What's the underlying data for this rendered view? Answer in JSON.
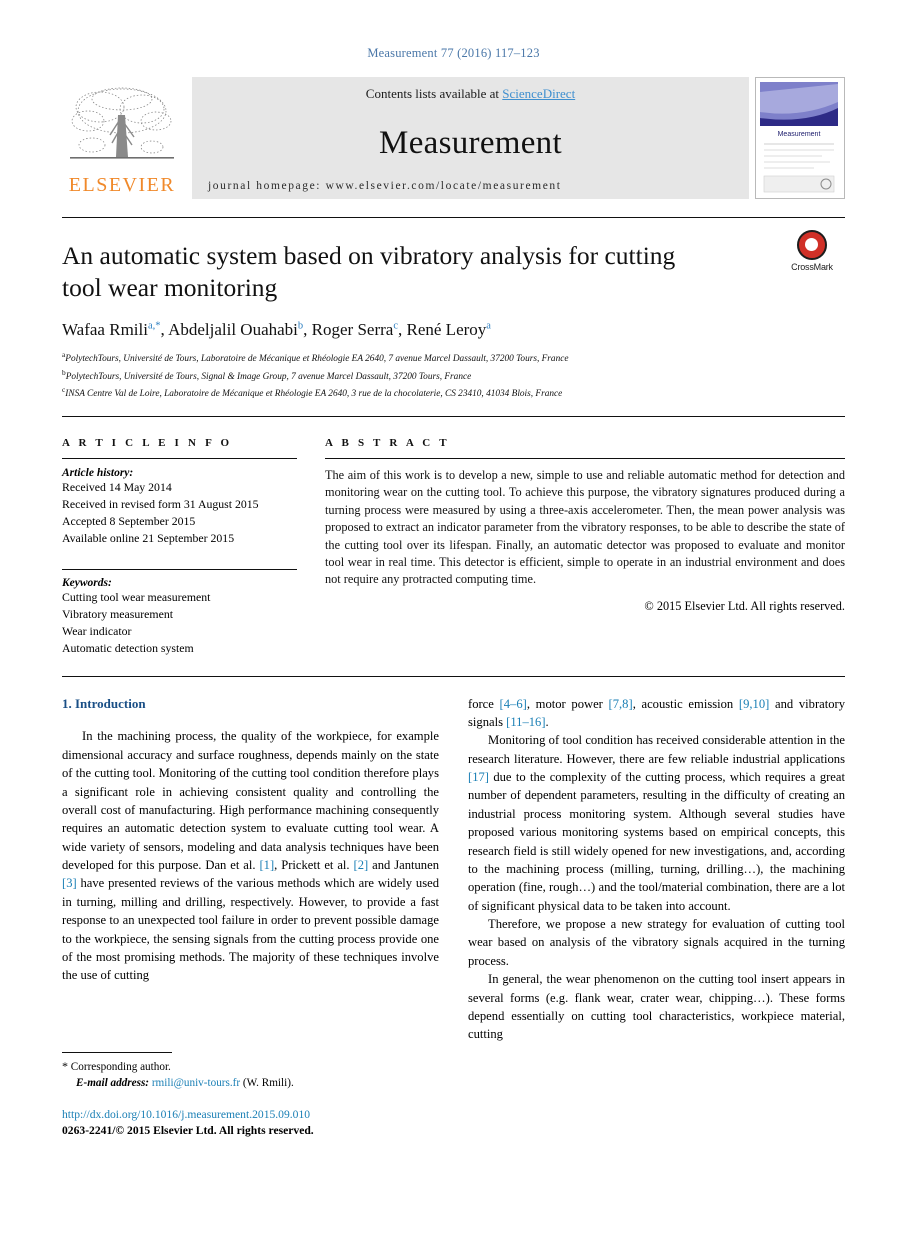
{
  "running_head": "Measurement 77 (2016) 117–123",
  "masthead": {
    "contents_prefix": "Contents lists available at ",
    "sciencedirect": "ScienceDirect",
    "journal_name": "Measurement",
    "homepage": "journal homepage: www.elsevier.com/locate/measurement",
    "publisher_logo_text": "ELSEVIER",
    "cover_journal_name": "Measurement"
  },
  "article": {
    "title": "An automatic system based on vibratory analysis for cutting tool wear monitoring",
    "authors": [
      {
        "name": "Wafaa Rmili",
        "marks": "a,*"
      },
      {
        "name": "Abdeljalil Ouahabi",
        "marks": "b"
      },
      {
        "name": "Roger Serra",
        "marks": "c"
      },
      {
        "name": "René Leroy",
        "marks": "a"
      }
    ],
    "authors_line": "Wafaa Rmili a,*, Abdeljalil Ouahabi b, Roger Serra c, René Leroy a",
    "affiliations": [
      {
        "mark": "a",
        "text": "PolytechTours, Université de Tours, Laboratoire de Mécanique et Rhéologie EA 2640, 7 avenue Marcel Dassault, 37200 Tours, France"
      },
      {
        "mark": "b",
        "text": "PolytechTours, Université de Tours, Signal & Image Group, 7 avenue Marcel Dassault, 37200 Tours, France"
      },
      {
        "mark": "c",
        "text": "INSA Centre Val de Loire, Laboratoire de Mécanique et Rhéologie EA 2640, 3 rue de la chocolaterie, CS 23410, 41034 Blois, France"
      }
    ],
    "crossmark_label": "CrossMark"
  },
  "article_info": {
    "heading": "A R T I C L E   I N F O",
    "history_label": "Article history:",
    "history": [
      "Received 14 May 2014",
      "Received in revised form 31 August 2015",
      "Accepted 8 September 2015",
      "Available online 21 September 2015"
    ],
    "keywords_label": "Keywords:",
    "keywords": [
      "Cutting tool wear measurement",
      "Vibratory measurement",
      "Wear indicator",
      "Automatic detection system"
    ]
  },
  "abstract": {
    "heading": "A B S T R A C T",
    "text": "The aim of this work is to develop a new, simple to use and reliable automatic method for detection and monitoring wear on the cutting tool. To achieve this purpose, the vibratory signatures produced during a turning process were measured by using a three-axis accelerometer. Then, the mean power analysis was proposed to extract an indicator parameter from the vibratory responses, to be able to describe the state of the cutting tool over its lifespan. Finally, an automatic detector was proposed to evaluate and monitor tool wear in real time. This detector is efficient, simple to operate in an industrial environment and does not require any protracted computing time.",
    "copyright": "© 2015 Elsevier Ltd. All rights reserved."
  },
  "body": {
    "section_title": "1. Introduction",
    "left_p1_a": "In the machining process, the quality of the workpiece, for example dimensional accuracy and surface roughness, depends mainly on the state of the cutting tool. Monitoring of the cutting tool condition therefore plays a significant role in achieving consistent quality and controlling the overall cost of manufacturing. High performance machining consequently requires an automatic detection system to evaluate cutting tool wear. A wide variety of sensors, modeling and data analysis techniques have been developed for this purpose. Dan et al. ",
    "cite_1": "[1]",
    "left_p1_b": ", Prickett et al. ",
    "cite_2": "[2]",
    "left_p1_c": " and Jantunen ",
    "cite_3": "[3]",
    "left_p1_d": " have presented reviews of the various methods which are widely used in turning, milling and drilling, respectively. However, to provide a fast response to an unexpected tool failure in order to prevent possible damage to the workpiece, the sensing signals from the cutting process provide one of the most promising methods. The majority of these techniques involve the use of cutting",
    "right_p1_a": "force ",
    "cite_4_6": "[4–6]",
    "right_p1_b": ", motor power ",
    "cite_7_8": "[7,8]",
    "right_p1_c": ", acoustic emission ",
    "cite_9_10": "[9,10]",
    "right_p1_d": " and vibratory signals ",
    "cite_11_16": "[11–16]",
    "right_p1_e": ".",
    "right_p2_a": "Monitoring of tool condition has received considerable attention in the research literature. However, there are few reliable industrial applications ",
    "cite_17": "[17]",
    "right_p2_b": " due to the complexity of the cutting process, which requires a great number of dependent parameters, resulting in the difficulty of creating an industrial process monitoring system. Although several studies have proposed various monitoring systems based on empirical concepts, this research field is still widely opened for new investigations, and, according to the machining process (milling, turning, drilling…), the machining operation (fine, rough…) and the tool/material combination, there are a lot of significant physical data to be taken into account.",
    "right_p3": "Therefore, we propose a new strategy for evaluation of cutting tool wear based on analysis of the vibratory signals acquired in the turning process.",
    "right_p4": "In general, the wear phenomenon on the cutting tool insert appears in several forms (e.g. flank wear, crater wear, chipping…). These forms depend essentially on cutting tool characteristics, workpiece material, cutting"
  },
  "footnotes": {
    "corresponding_star": "*",
    "corresponding_text": "Corresponding author.",
    "email_label": "E-mail address:",
    "email": "rmili@univ-tours.fr",
    "email_owner": "(W. Rmili)."
  },
  "footer": {
    "doi": "http://dx.doi.org/10.1016/j.measurement.2015.09.010",
    "issn_line": "0263-2241/© 2015 Elsevier Ltd. All rights reserved."
  },
  "colors": {
    "link_blue": "#1a7fb5",
    "running_head_blue": "#4a77a8",
    "section_blue": "#1a4f86",
    "elsevier_orange": "#f0892a",
    "band_gray": "#e6e6e6",
    "crossmark_red": "#d03027"
  }
}
